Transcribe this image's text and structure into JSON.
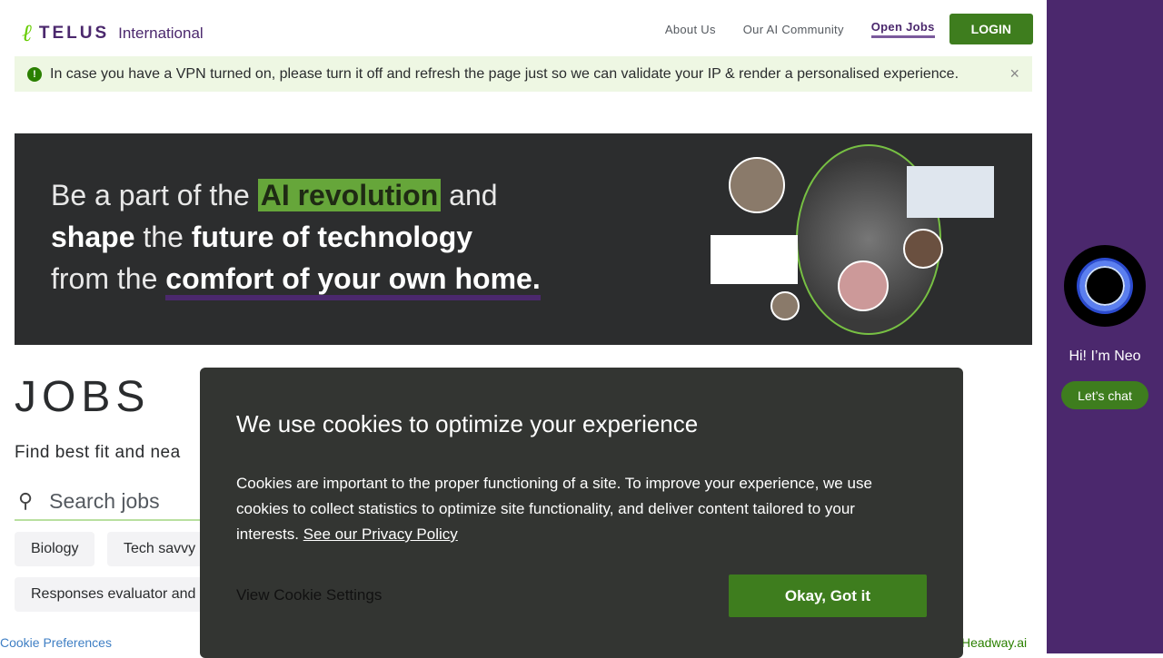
{
  "header": {
    "logo_text": "TELUS International",
    "nav": [
      "About Us",
      "Our AI Community",
      "Open Jobs"
    ],
    "login": "LOGIN"
  },
  "alert": {
    "message": "In case you have a VPN turned on, please turn it off and refresh the page just so we can validate your IP & render a personalised experience.",
    "icon": "exclamation-icon",
    "close": "×"
  },
  "hero": {
    "line1_a": "Be a part of the ",
    "line1_b": "AI revolution",
    "line1_c": " and",
    "line2_a": "shape",
    "line2_b": " the ",
    "line2_c": "future of technology",
    "line3_a": "from the ",
    "line3_b": "comfort of your own home."
  },
  "jobs": {
    "title": "JOBS",
    "subtitle": "Find best fit and nea",
    "search_placeholder": "Search jobs",
    "chips": [
      "Biology",
      "Tech savvy",
      "Responses evaluator and"
    ]
  },
  "neo": {
    "greeting": "Hi! I’m Neo",
    "chat": "Let’s chat"
  },
  "cookie": {
    "title": "We use cookies to optimize your experience",
    "body": "Cookies are important to the proper functioning of a site. To improve your experience, we use cookies to collect statistics to optimize site functionality, and deliver content tailored to your interests. ",
    "link": "See our Privacy Policy",
    "settings": "View Cookie Settings",
    "ok": "Okay, Got it"
  },
  "footer": {
    "cookie_prefs": "Cookie Preferences",
    "headway": "Headway.ai"
  }
}
